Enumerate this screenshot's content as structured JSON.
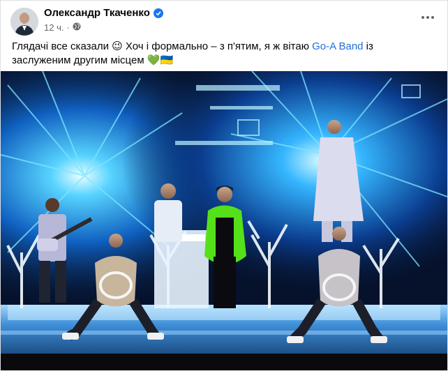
{
  "post": {
    "author_name": "Олександр Ткаченко",
    "time": "12 ч.",
    "separator": "·",
    "text_before_link": "Глядачі все сказали 😉 Хоч і формально – з п'ятим, я ж вітаю ",
    "link_text": "Go-A Band",
    "text_after_link": " із заслуженим другим місцем 💚🇺🇦"
  },
  "icons": {
    "verified": "verified-badge-icon",
    "audience": "globe-icon",
    "more": "more-options-icon"
  },
  "colors": {
    "link": "#216fdb",
    "verified": "#1877f2",
    "stage_blue": "#1e9ff0",
    "costume_green": "#55e01a"
  }
}
